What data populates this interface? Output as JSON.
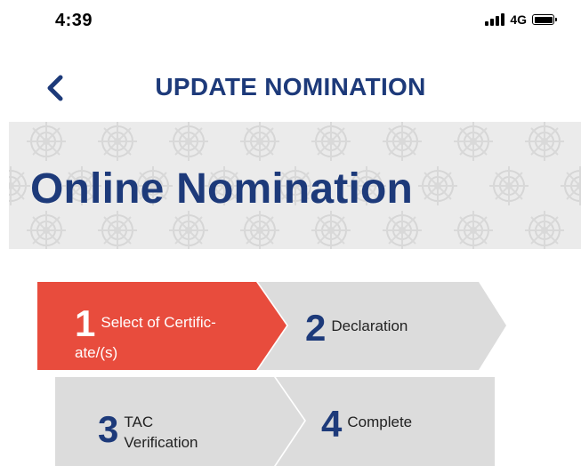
{
  "status_bar": {
    "time": "4:39",
    "network": "4G"
  },
  "header": {
    "back_icon": "chevron-left-icon",
    "title": "UPDATE NOMINATION"
  },
  "banner": {
    "title": "Online Nomination"
  },
  "steps": [
    {
      "number": "1",
      "label": "Select of Certific-",
      "label_line2": "ate/(s)",
      "active": true
    },
    {
      "number": "2",
      "label": "Declaration",
      "active": false
    },
    {
      "number": "3",
      "label": "TAC Verification",
      "active": false
    },
    {
      "number": "4",
      "label": "Complete",
      "active": false
    }
  ],
  "colors": {
    "brand_navy": "#1d3a7a",
    "active_step": "#e84c3d",
    "inactive_step": "#dcdcdc"
  }
}
